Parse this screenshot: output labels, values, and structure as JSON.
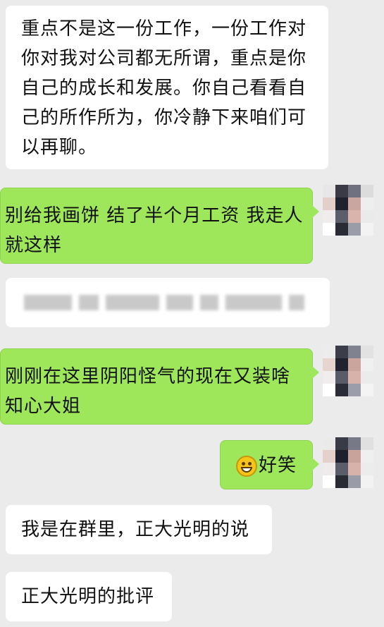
{
  "messages": [
    {
      "side": "left",
      "text": "重点不是这一份工作，一份工作对你对我对公司都无所谓，重点是你自己的成长和发展。你自己看看自己的所作所为，你冷静下来咱们可以再聊。"
    },
    {
      "side": "right",
      "text": "别给我画饼 结了半个月工资 我走人 就这样"
    },
    {
      "side": "right",
      "text": "刚刚在这里阴阳怪气的现在又装啥知心大姐"
    },
    {
      "side": "right",
      "text": "好笑",
      "emoji": "grinning-face-icon"
    },
    {
      "side": "left",
      "text": "我是在群里，正大光明的说"
    },
    {
      "side": "left",
      "text": "正大光明的批评"
    }
  ],
  "colors": {
    "background": "#ebebeb",
    "incoming_bubble": "#ffffff",
    "outgoing_bubble": "#9ee65a"
  }
}
